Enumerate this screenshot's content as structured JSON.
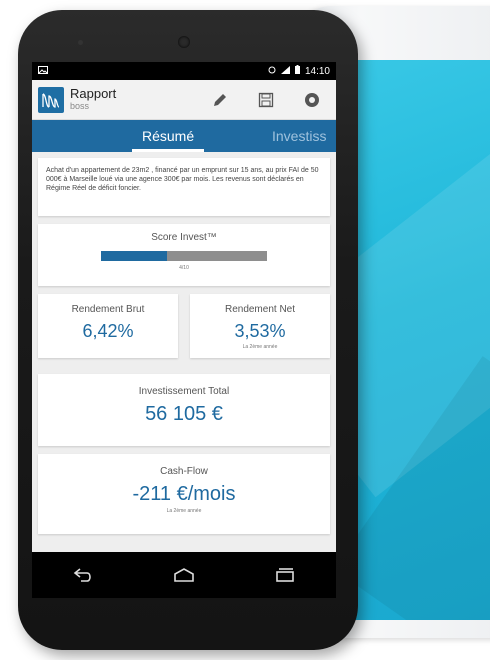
{
  "colors": {
    "brand": "#1f6aa0",
    "accent_bg": "#21b6d8",
    "card_bg": "#ffffff"
  },
  "statusbar": {
    "left_icon": "image-notification-icon",
    "time": "14:10",
    "icons": [
      "alarm-icon",
      "signal-icon",
      "battery-icon"
    ]
  },
  "actionbar": {
    "title": "Rapport",
    "subtitle": "boss",
    "icons": [
      "edit-icon",
      "save-icon",
      "settings-icon"
    ]
  },
  "tabs": [
    {
      "label": "Résumé",
      "active": true
    },
    {
      "label": "Investiss",
      "active": false
    }
  ],
  "description": "Achat d'un appartement de 23m2 , financé par un emprunt sur 15 ans,  au prix FAI de 50 000€ à Marseille loué via une agence 300€ par mois.  Les revenus sont déclarés en Régime Réel de déficit foncier.",
  "score": {
    "label": "Score Invest™",
    "value_text": "4/10",
    "value": 0.4
  },
  "rendement_brut": {
    "label": "Rendement Brut",
    "value": "6,42%"
  },
  "rendement_net": {
    "label": "Rendement Net",
    "value": "3,53%",
    "sub": "La 2ème année"
  },
  "investissement": {
    "label": "Investissement Total",
    "value": "56 105 €"
  },
  "cashflow": {
    "label": "Cash-Flow",
    "value": "-211 €/mois",
    "sub": "La 2ème année"
  },
  "navbar": {
    "icons": [
      "back-icon",
      "home-icon",
      "recent-apps-icon"
    ]
  }
}
